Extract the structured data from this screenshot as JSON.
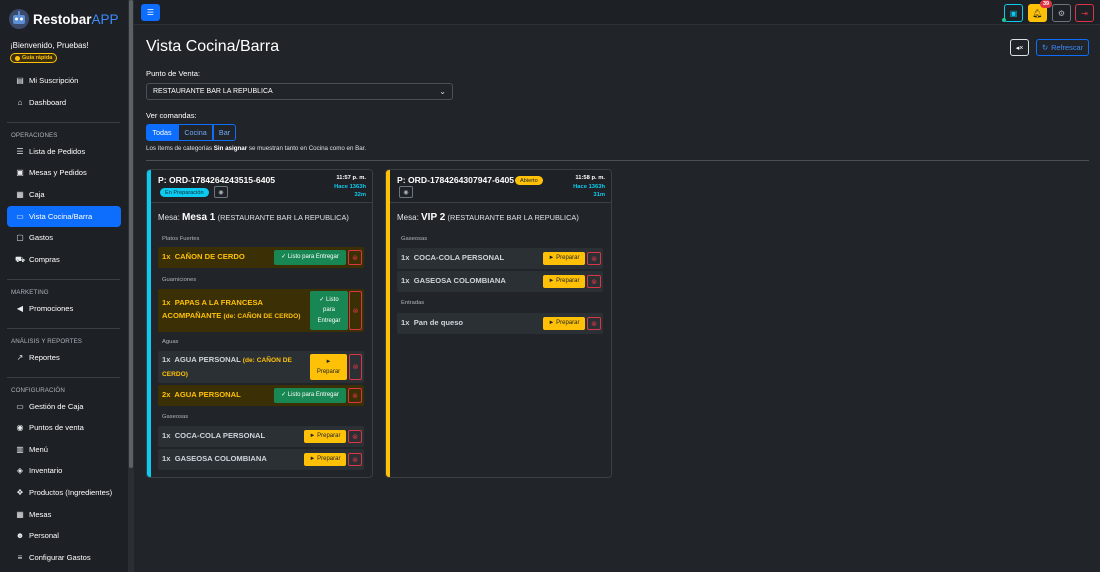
{
  "brand": {
    "name": "Restobar",
    "suffix": "APP"
  },
  "sidebar": {
    "welcome": "¡Bienvenido, Pruebas!",
    "guide_label": "Guía rápida",
    "items": [
      {
        "label": "Mi Suscripción",
        "icon": "subscription-icon"
      },
      {
        "label": "Dashboard",
        "icon": "home-icon"
      },
      {
        "label": "Lista de Pedidos",
        "icon": "list-icon"
      },
      {
        "label": "Mesas y Pedidos",
        "icon": "tables-icon"
      },
      {
        "label": "Caja",
        "icon": "cash-register-icon"
      },
      {
        "label": "Vista Cocina/Barra",
        "icon": "monitor-icon",
        "active": true
      },
      {
        "label": "Gastos",
        "icon": "wallet-icon"
      },
      {
        "label": "Compras",
        "icon": "cart-icon"
      },
      {
        "label": "Promociones",
        "icon": "megaphone-icon"
      },
      {
        "label": "Reportes",
        "icon": "chart-icon"
      },
      {
        "label": "Gestión de Caja",
        "icon": "cash-icon"
      },
      {
        "label": "Puntos de venta",
        "icon": "location-pin-icon"
      },
      {
        "label": "Menú",
        "icon": "book-icon"
      },
      {
        "label": "Inventario",
        "icon": "box-icon"
      },
      {
        "label": "Productos (Ingredientes)",
        "icon": "boxes-icon"
      },
      {
        "label": "Mesas",
        "icon": "grid-icon"
      },
      {
        "label": "Personal",
        "icon": "people-icon"
      },
      {
        "label": "Configurar Gastos",
        "icon": "sliders-icon"
      }
    ],
    "sections": [
      "OPERACIONES",
      "MARKETING",
      "ANÁLISIS Y REPORTES",
      "CONFIGURACIÓN"
    ]
  },
  "topbar": {
    "notifications_count": "39"
  },
  "page": {
    "title": "Vista Cocina/Barra",
    "refresh_label": "Refrescar",
    "pos_label": "Punto de Venta:",
    "pos_value": "RESTAURANTE BAR LA REPUBLICA",
    "filter_label": "Ver comandas:",
    "filters": [
      {
        "label": "Todas",
        "active": true
      },
      {
        "label": "Cocina"
      },
      {
        "label": "Bar"
      }
    ],
    "note_pre": "Los ítems de categorías ",
    "note_bold": "Sin asignar",
    "note_post": " se muestran tanto en Cocina como en Bar."
  },
  "orders": [
    {
      "id": "P: ORD-1784264243515-6405",
      "status": "En Preparación",
      "accent": "#0dcaf0",
      "time": "11:57 p. m.",
      "ago1": "Hace 1363h",
      "ago2": "32m",
      "mesa_label": "Mesa: ",
      "mesa": "Mesa 1",
      "location": "(RESTAURANTE BAR LA REPUBLICA)",
      "groups": [
        {
          "category": "Platos Fuertes",
          "items": [
            {
              "qty": "1x",
              "name": "CAÑON DE CERDO",
              "action": "Listo para Entregar"
            }
          ]
        },
        {
          "category": "Guarniciones",
          "items": [
            {
              "qty": "1x",
              "name": "PAPAS A LA FRANCESA",
              "name2": "ACOMPAÑANTE",
              "of": "(de: CAÑON DE CERDO)",
              "action_lines": [
                "Listo",
                "para",
                "Entregar"
              ]
            }
          ]
        },
        {
          "category": "Aguas",
          "items": [
            {
              "qty": "1x",
              "name": "AGUA PERSONAL",
              "of": "(de: CAÑON DE",
              "of2": "CERDO)",
              "action": "Preparar"
            },
            {
              "qty": "2x",
              "name": "AGUA PERSONAL",
              "action": "Listo para Entregar"
            }
          ]
        },
        {
          "category": "Gaseosas",
          "items": [
            {
              "qty": "1x",
              "name": "COCA-COLA PERSONAL",
              "action": "Preparar"
            },
            {
              "qty": "1x",
              "name": "GASEOSA COLOMBIANA",
              "action": "Preparar"
            }
          ]
        }
      ]
    },
    {
      "id": "P: ORD-1784264307947-6405",
      "status": "Abierto",
      "accent": "#ffc107",
      "time": "11:58 p. m.",
      "ago1": "Hace 1363h",
      "ago2": "31m",
      "mesa_label": "Mesa: ",
      "mesa": "VIP 2",
      "location": "(RESTAURANTE BAR LA REPUBLICA)",
      "groups": [
        {
          "category": "Gaseosas",
          "items": [
            {
              "qty": "1x",
              "name": "COCA-COLA PERSONAL",
              "action": "Preparar"
            },
            {
              "qty": "1x",
              "name": "GASEOSA COLOMBIANA",
              "action": "Preparar"
            }
          ]
        },
        {
          "category": "Entradas",
          "items": [
            {
              "qty": "1x",
              "name": "Pan de queso",
              "action": "Preparar"
            }
          ]
        }
      ]
    }
  ]
}
